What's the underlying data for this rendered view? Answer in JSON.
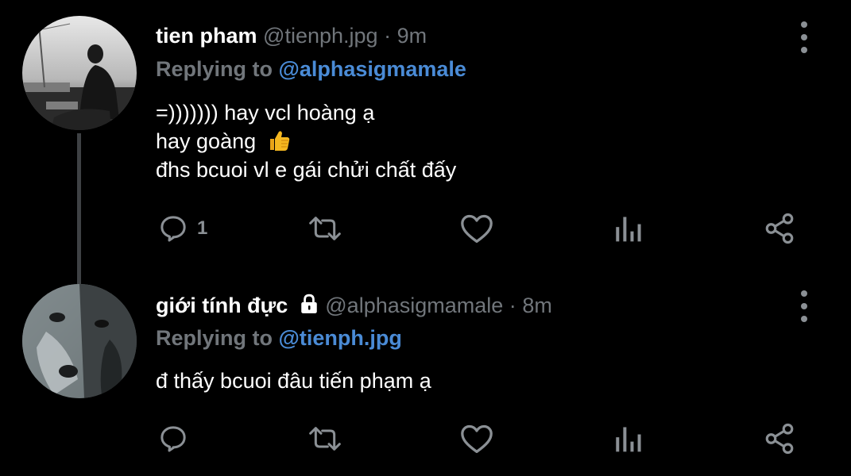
{
  "tweets": [
    {
      "name": "tien pham",
      "handle": "@tienph.jpg",
      "sep": "·",
      "time": "9m",
      "replying_prefix": "Replying to",
      "replying_to": "@alphasigmamale",
      "lines": [
        "=))))))) hay vcl hoàng ạ",
        "hay goàng",
        "đhs bcuoi vl e gái chửi chất đấy"
      ],
      "emoji": "thumbs-up-emoji",
      "reply_count": "1",
      "avatar": "avatar-man-photo"
    },
    {
      "name": "giới tính đực",
      "handle": "@alphasigmamale",
      "sep": "·",
      "time": "8m",
      "replying_prefix": "Replying to",
      "replying_to": "@tienph.jpg",
      "lines": [
        "đ thấy bcuoi đâu tiến phạm ạ"
      ],
      "reply_count": "",
      "avatar": "avatar-wolf-face-photo",
      "protected_icon": "lock-icon"
    }
  ],
  "colors": {
    "background": "#000000",
    "name": "#ffffff",
    "meta": "#71767b",
    "mention": "#4a8bd6",
    "icons": "#8b9095",
    "thread_line": "#3e4144"
  }
}
